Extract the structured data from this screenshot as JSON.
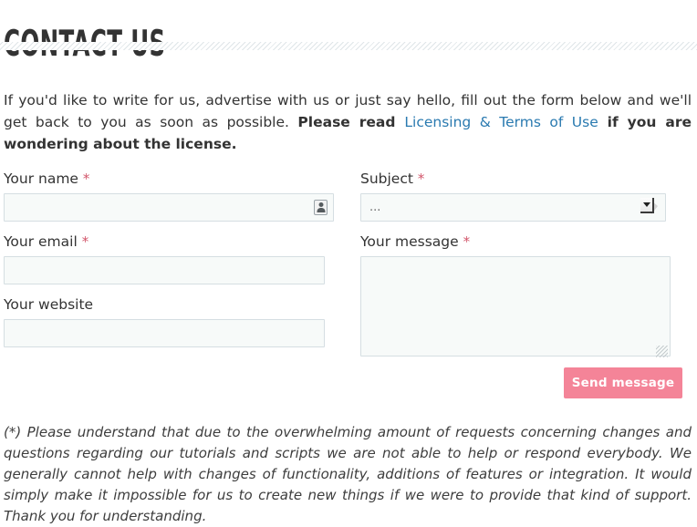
{
  "page": {
    "title": "CONTACT US"
  },
  "intro": {
    "part1": "If you'd like to write for us, advertise with us or just say hello, fill out the form below and we'll get back to you as soon as possible. ",
    "bold_before": "Please read ",
    "link_text": "Licensing & Terms of Use",
    "bold_after": " if you are wondering about the license.",
    "link_color": "#2a7ab0"
  },
  "form": {
    "name": {
      "label": "Your name",
      "required_marker": "*",
      "value": "",
      "placeholder": "",
      "icon": "contact-card-autofill-icon"
    },
    "email": {
      "label": "Your email",
      "required_marker": "*",
      "value": "",
      "placeholder": ""
    },
    "website": {
      "label": "Your website",
      "required_marker": "",
      "value": "",
      "placeholder": ""
    },
    "subject": {
      "label": "Subject",
      "required_marker": "*",
      "selected": "...",
      "options": [
        "..."
      ]
    },
    "message": {
      "label": "Your message",
      "required_marker": "*",
      "value": "",
      "placeholder": ""
    },
    "submit": {
      "label": "Send message",
      "color": "#f48498",
      "text_color": "#ffffff"
    },
    "required_color": "#d2566b",
    "input_background": "#f7faf9",
    "input_border": "#d5dee2"
  },
  "footnote": {
    "text": "(*) Please understand that due to the overwhelming amount of requests concerning changes and questions regarding our tutorials and scripts we are not able to help or respond everybody. We generally cannot help with changes of functionality, additions of features or integration. It would simply make it impossible for us to create new things if we were to provide that kind of support. Thank you for understanding."
  }
}
